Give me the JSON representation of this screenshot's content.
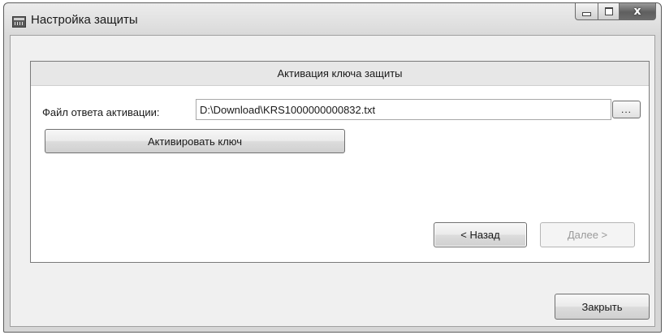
{
  "window": {
    "title": "Настройка защиты",
    "icon": "app-window-icon",
    "caption": {
      "minimize": "minimize-icon",
      "maximize": "maximize-icon",
      "close_glyph": "x"
    }
  },
  "panel": {
    "header": "Активация ключа защиты",
    "file_label": "Файл ответа активации:",
    "file_value": "D:\\Download\\KRS1000000000832.txt",
    "browse_label": "...",
    "activate_label": "Активировать ключ",
    "back_label": "< Назад",
    "next_label": "Далее >",
    "next_enabled": false
  },
  "footer": {
    "close_label": "Закрыть"
  }
}
